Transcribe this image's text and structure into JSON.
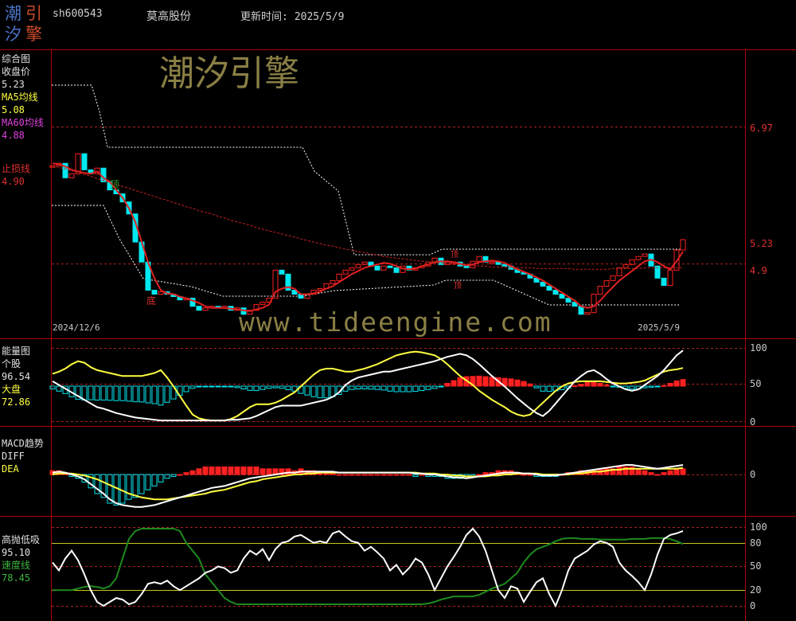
{
  "header": {
    "logo_chars": [
      "潮",
      "引",
      "汐",
      "擎"
    ],
    "stock_code": "sh600543",
    "stock_name": "莫高股份",
    "update_label": "更新时间:",
    "update_date": "2025/5/9"
  },
  "watermarks": {
    "brand": "潮汐引擎",
    "url": "www.tideengine.com"
  },
  "colors": {
    "background": "#000000",
    "frame": "#b00000",
    "up": "#ff2020",
    "down": "#00e8f0",
    "ma5": "#ffffff",
    "ma60": "#cc2020",
    "yellow": "#ffff40",
    "green_line": "#1e8a1e"
  },
  "panels": {
    "main": {
      "title": "综合图",
      "close_label": "收盘价",
      "close_value": "5.23",
      "ma5_label": "MA5均线",
      "ma5_value": "5.08",
      "ma60_label": "MA60均线",
      "ma60_value": "4.88",
      "stop_label": "止损线",
      "stop_value": "4.90",
      "axis_labels": [
        "6.97",
        "5.23",
        "4.9"
      ],
      "date_start": "2024/12/6",
      "date_end": "2025/5/9",
      "markers": [
        "顶",
        "底",
        "顶",
        "顶"
      ]
    },
    "energy": {
      "title": "能量图",
      "stock_label": "个股",
      "stock_value": "96.54",
      "market_label": "大盘",
      "market_value": "72.86",
      "axis_labels": [
        "100",
        "50",
        "0"
      ]
    },
    "macd": {
      "title": "MACD趋势",
      "diff_label": "DIFF",
      "dea_label": "DEA",
      "axis_labels": [
        "0"
      ]
    },
    "tide": {
      "title": "高抛低吸",
      "value": "95.10",
      "speed_label": "速度线",
      "speed_value": "78.45",
      "axis_labels": [
        "100",
        "80",
        "50",
        "20",
        "0"
      ]
    }
  },
  "chart_data": [
    {
      "type": "line",
      "title": "综合图",
      "x_range": [
        "2024/12/6",
        "2025/5/9"
      ],
      "n_points": 100,
      "ylim": [
        4.0,
        7.6
      ],
      "series": [
        {
          "name": "收盘价",
          "values": [
            6.15,
            6.18,
            6.0,
            6.05,
            6.3,
            6.1,
            6.05,
            6.12,
            5.95,
            5.85,
            5.8,
            5.7,
            5.55,
            5.2,
            4.95,
            4.6,
            4.55,
            4.58,
            4.55,
            4.52,
            4.48,
            4.5,
            4.4,
            4.35,
            4.38,
            4.4,
            4.38,
            4.4,
            4.35,
            4.38,
            4.3,
            4.35,
            4.42,
            4.45,
            4.5,
            4.85,
            4.8,
            4.6,
            4.55,
            4.5,
            4.55,
            4.6,
            4.62,
            4.68,
            4.72,
            4.8,
            4.85,
            4.88,
            4.92,
            4.95,
            4.9,
            4.85,
            4.9,
            4.88,
            4.82,
            4.9,
            4.85,
            4.88,
            4.9,
            4.95,
            5.0,
            4.92,
            4.95,
            4.95,
            4.9,
            4.88,
            4.96,
            5.02,
            4.95,
            4.95,
            4.92,
            4.9,
            4.86,
            4.82,
            4.8,
            4.75,
            4.7,
            4.65,
            4.6,
            4.55,
            4.5,
            4.45,
            4.4,
            4.3,
            4.32,
            4.55,
            4.65,
            4.72,
            4.78,
            4.88,
            4.92,
            4.98,
            5.02,
            5.05,
            4.9,
            4.75,
            4.66,
            4.85,
            5.1,
            5.23
          ]
        },
        {
          "name": "MA5均线",
          "values": [
            6.18,
            6.17,
            6.14,
            6.1,
            6.08,
            6.06,
            6.05,
            6.08,
            6.0,
            5.95,
            5.85,
            5.75,
            5.62,
            5.45,
            5.2,
            4.95,
            4.75,
            4.6,
            4.56,
            4.55,
            4.52,
            4.5,
            4.47,
            4.44,
            4.4,
            4.38,
            4.38,
            4.38,
            4.37,
            4.36,
            4.35,
            4.34,
            4.36,
            4.38,
            4.42,
            4.58,
            4.62,
            4.64,
            4.62,
            4.55,
            4.55,
            4.56,
            4.58,
            4.62,
            4.65,
            4.7,
            4.75,
            4.8,
            4.84,
            4.88,
            4.9,
            4.92,
            4.94,
            4.93,
            4.9,
            4.87,
            4.86,
            4.87,
            4.9,
            4.92,
            4.95,
            4.96,
            4.96,
            4.95,
            4.93,
            4.91,
            4.92,
            4.95,
            4.96,
            4.97,
            4.96,
            4.94,
            4.9,
            4.86,
            4.83,
            4.8,
            4.76,
            4.72,
            4.67,
            4.62,
            4.57,
            4.52,
            4.47,
            4.4,
            4.38,
            4.4,
            4.47,
            4.56,
            4.64,
            4.72,
            4.78,
            4.84,
            4.9,
            4.96,
            4.98,
            4.95,
            4.9,
            4.86,
            4.96,
            5.08
          ]
        },
        {
          "name": "MA60均线",
          "values": [
            6.15,
            6.13,
            6.11,
            6.09,
            6.07,
            6.04,
            6.02,
            5.99,
            5.97,
            5.94,
            5.92,
            5.89,
            5.87,
            5.84,
            5.82,
            5.79,
            5.77,
            5.74,
            5.72,
            5.69,
            5.67,
            5.64,
            5.62,
            5.59,
            5.57,
            5.55,
            5.52,
            5.5,
            5.47,
            5.45,
            5.43,
            5.41,
            5.38,
            5.36,
            5.34,
            5.32,
            5.3,
            5.28,
            5.26,
            5.24,
            5.22,
            5.2,
            5.18,
            5.16,
            5.15,
            5.13,
            5.11,
            5.1,
            5.08,
            5.07,
            5.05,
            5.04,
            5.02,
            5.01,
            5.0,
            4.99,
            4.98,
            4.97,
            4.96,
            4.95,
            4.94,
            4.94,
            4.93,
            4.92,
            4.92,
            4.91,
            4.91,
            4.9,
            4.9,
            4.89,
            4.89,
            4.89,
            4.88,
            4.88,
            4.88,
            4.88,
            4.87,
            4.87,
            4.87,
            4.87,
            4.87,
            4.87,
            4.86,
            4.86,
            4.86,
            4.86,
            4.86,
            4.86,
            4.87,
            4.87,
            4.87,
            4.87,
            4.87,
            4.88,
            4.88,
            4.88,
            4.88,
            4.88,
            4.88,
            4.88
          ]
        }
      ]
    },
    {
      "type": "line",
      "title": "能量图",
      "n_points": 100,
      "ylim": [
        0,
        100
      ],
      "series": [
        {
          "name": "个股",
          "values": [
            55,
            50,
            45,
            40,
            35,
            30,
            25,
            20,
            18,
            15,
            12,
            10,
            8,
            6,
            5,
            4,
            3,
            2,
            2,
            2,
            2,
            2,
            2,
            2,
            2,
            2,
            2,
            2,
            3,
            3,
            4,
            5,
            8,
            12,
            16,
            20,
            22,
            22,
            22,
            22,
            24,
            26,
            28,
            30,
            34,
            40,
            50,
            56,
            60,
            62,
            64,
            66,
            68,
            68,
            70,
            72,
            74,
            76,
            78,
            80,
            82,
            85,
            88,
            90,
            92,
            90,
            85,
            78,
            70,
            62,
            55,
            48,
            40,
            32,
            25,
            18,
            12,
            8,
            15,
            25,
            35,
            45,
            55,
            62,
            68,
            70,
            65,
            58,
            52,
            48,
            44,
            42,
            44,
            50,
            56,
            62,
            70,
            80,
            90,
            96.54
          ]
        },
        {
          "name": "大盘",
          "values": [
            65,
            68,
            72,
            78,
            82,
            80,
            74,
            70,
            68,
            66,
            64,
            62,
            62,
            62,
            62,
            64,
            66,
            70,
            60,
            48,
            35,
            22,
            10,
            5,
            3,
            2,
            2,
            2,
            4,
            8,
            14,
            20,
            24,
            24,
            24,
            26,
            30,
            35,
            40,
            48,
            56,
            64,
            70,
            72,
            72,
            70,
            68,
            68,
            70,
            72,
            75,
            78,
            82,
            86,
            90,
            92,
            94,
            95,
            94,
            92,
            90,
            85,
            78,
            70,
            62,
            56,
            50,
            42,
            36,
            30,
            25,
            20,
            14,
            10,
            8,
            10,
            18,
            26,
            34,
            42,
            48,
            52,
            54,
            55,
            55,
            55,
            55,
            54,
            53,
            52,
            52,
            53,
            54,
            56,
            60,
            64,
            68,
            70,
            71,
            72.86
          ]
        }
      ]
    },
    {
      "type": "line",
      "title": "MACD趋势",
      "n_points": 100,
      "series": [
        {
          "name": "DIFF",
          "values": [
            0.02,
            0.03,
            0.02,
            0.0,
            -0.02,
            -0.05,
            -0.1,
            -0.15,
            -0.2,
            -0.26,
            -0.3,
            -0.32,
            -0.33,
            -0.34,
            -0.34,
            -0.33,
            -0.32,
            -0.3,
            -0.28,
            -0.26,
            -0.24,
            -0.22,
            -0.2,
            -0.18,
            -0.16,
            -0.14,
            -0.13,
            -0.12,
            -0.1,
            -0.08,
            -0.06,
            -0.04,
            -0.03,
            -0.02,
            -0.01,
            0.0,
            0.01,
            0.02,
            0.02,
            0.03,
            0.03,
            0.03,
            0.03,
            0.03,
            0.03,
            0.02,
            0.02,
            0.02,
            0.02,
            0.02,
            0.02,
            0.02,
            0.02,
            0.02,
            0.02,
            0.02,
            0.02,
            0.01,
            0.01,
            0.0,
            0.0,
            -0.01,
            -0.02,
            -0.03,
            -0.03,
            -0.04,
            -0.03,
            -0.02,
            -0.01,
            0.0,
            0.01,
            0.02,
            0.02,
            0.02,
            0.01,
            0.01,
            0.0,
            -0.01,
            -0.01,
            -0.01,
            0.0,
            0.01,
            0.02,
            0.03,
            0.04,
            0.05,
            0.06,
            0.07,
            0.08,
            0.09,
            0.1,
            0.1,
            0.09,
            0.08,
            0.07,
            0.06,
            0.07,
            0.08,
            0.09,
            0.1
          ]
        },
        {
          "name": "DEA",
          "values": [
            0.0,
            0.01,
            0.01,
            0.01,
            0.0,
            -0.01,
            -0.03,
            -0.05,
            -0.08,
            -0.11,
            -0.14,
            -0.17,
            -0.2,
            -0.22,
            -0.24,
            -0.25,
            -0.26,
            -0.26,
            -0.26,
            -0.25,
            -0.24,
            -0.23,
            -0.22,
            -0.21,
            -0.2,
            -0.18,
            -0.17,
            -0.16,
            -0.14,
            -0.12,
            -0.1,
            -0.08,
            -0.07,
            -0.05,
            -0.04,
            -0.03,
            -0.02,
            -0.01,
            0.0,
            0.0,
            0.01,
            0.01,
            0.02,
            0.02,
            0.02,
            0.02,
            0.02,
            0.02,
            0.02,
            0.02,
            0.02,
            0.02,
            0.02,
            0.02,
            0.02,
            0.02,
            0.02,
            0.02,
            0.01,
            0.01,
            0.01,
            0.0,
            0.0,
            -0.01,
            -0.01,
            -0.02,
            -0.02,
            -0.02,
            -0.02,
            -0.01,
            -0.01,
            0.0,
            0.0,
            0.01,
            0.01,
            0.01,
            0.01,
            0.0,
            0.0,
            0.0,
            0.0,
            0.0,
            0.01,
            0.01,
            0.02,
            0.03,
            0.03,
            0.04,
            0.05,
            0.05,
            0.06,
            0.06,
            0.06,
            0.06,
            0.06,
            0.06,
            0.06,
            0.06,
            0.06,
            0.07
          ]
        }
      ]
    },
    {
      "type": "line",
      "title": "高抛低吸",
      "n_points": 100,
      "ylim": [
        0,
        100
      ],
      "series": [
        {
          "name": "高抛低吸",
          "values": [
            55,
            45,
            60,
            70,
            58,
            40,
            20,
            5,
            0,
            5,
            10,
            8,
            2,
            5,
            15,
            28,
            30,
            28,
            32,
            25,
            20,
            25,
            30,
            35,
            42,
            45,
            50,
            48,
            42,
            45,
            60,
            70,
            65,
            72,
            58,
            72,
            80,
            82,
            88,
            90,
            85,
            80,
            82,
            80,
            92,
            95,
            88,
            82,
            80,
            70,
            75,
            68,
            60,
            45,
            52,
            40,
            48,
            60,
            55,
            40,
            20,
            35,
            50,
            62,
            75,
            90,
            98,
            88,
            70,
            45,
            20,
            10,
            25,
            22,
            5,
            18,
            30,
            35,
            15,
            0,
            20,
            45,
            60,
            65,
            70,
            78,
            82,
            80,
            75,
            55,
            45,
            38,
            30,
            20,
            40,
            65,
            85,
            90,
            92,
            95.1
          ]
        },
        {
          "name": "速度线",
          "values": [
            20,
            20,
            20,
            20,
            22,
            24,
            25,
            24,
            22,
            25,
            35,
            60,
            85,
            95,
            98,
            98,
            98,
            98,
            98,
            98,
            95,
            80,
            70,
            60,
            40,
            30,
            20,
            10,
            5,
            2,
            2,
            2,
            2,
            2,
            2,
            2,
            2,
            2,
            2,
            2,
            2,
            2,
            2,
            2,
            2,
            2,
            2,
            2,
            2,
            2,
            2,
            2,
            2,
            2,
            2,
            2,
            2,
            2,
            2,
            3,
            5,
            8,
            10,
            12,
            12,
            12,
            12,
            14,
            18,
            22,
            25,
            28,
            35,
            42,
            55,
            65,
            72,
            75,
            78,
            82,
            85,
            86,
            86,
            85,
            85,
            85,
            84,
            84,
            84,
            84,
            84,
            85,
            85,
            85,
            86,
            86,
            86,
            85,
            82,
            78.45
          ]
        }
      ]
    }
  ]
}
